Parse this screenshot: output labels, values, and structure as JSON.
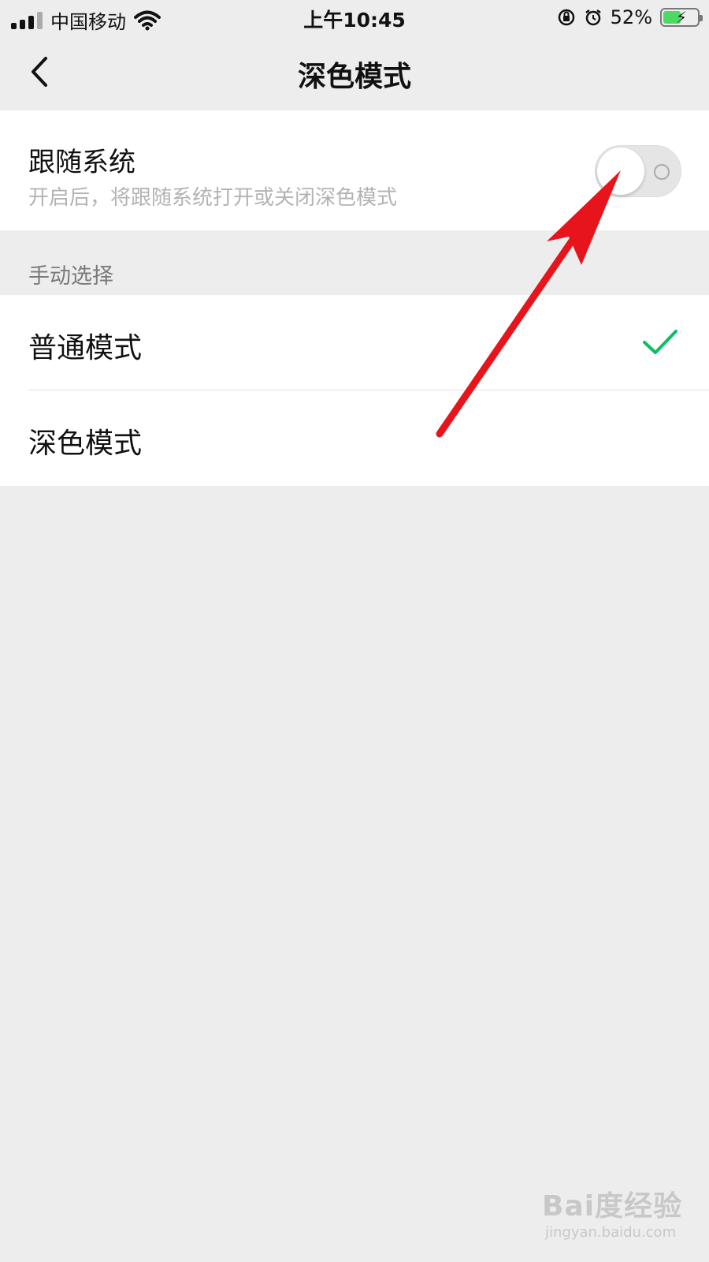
{
  "status_bar": {
    "carrier": "中国移动",
    "time": "上午10:45",
    "battery_percent": "52%",
    "battery_level": 0.52,
    "icons": [
      "signal-icon",
      "wifi-icon",
      "rotation-lock-icon",
      "alarm-icon",
      "battery-charging-icon"
    ]
  },
  "nav": {
    "title": "深色模式",
    "back_icon": "chevron-left-icon"
  },
  "follow_system": {
    "title": "跟随系统",
    "description": "开启后，将跟随系统打开或关闭深色模式",
    "toggle_on": false
  },
  "manual": {
    "section_label": "手动选择",
    "options": [
      {
        "label": "普通模式",
        "selected": true
      },
      {
        "label": "深色模式",
        "selected": false
      }
    ]
  },
  "colors": {
    "accent_green": "#07c160",
    "annotation_red": "#e8141b",
    "background": "#ededed"
  },
  "watermark": {
    "logo": "Bai度经验",
    "url": "jingyan.baidu.com"
  }
}
